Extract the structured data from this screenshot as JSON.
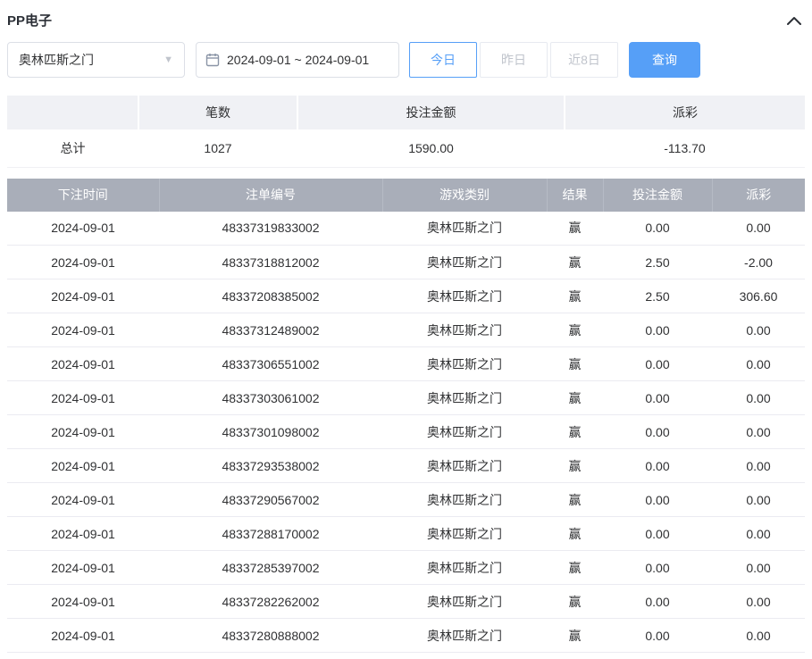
{
  "header": {
    "title": "PP电子"
  },
  "filters": {
    "game_select": {
      "value": "奥林匹斯之门"
    },
    "date_range": {
      "value": "2024-09-01 ~ 2024-09-01"
    },
    "quick_buttons": [
      {
        "label": "今日",
        "active": true
      },
      {
        "label": "昨日",
        "active": false
      },
      {
        "label": "近8日",
        "active": false
      }
    ],
    "search_label": "查询"
  },
  "summary": {
    "headers": [
      "",
      "笔数",
      "投注金额",
      "派彩"
    ],
    "row": {
      "label": "总计",
      "count": "1027",
      "bet_amount": "1590.00",
      "payout": "-113.70"
    }
  },
  "records": {
    "headers": [
      "下注时间",
      "注单编号",
      "游戏类别",
      "结果",
      "投注金额",
      "派彩"
    ],
    "rows": [
      {
        "date": "2024-09-01",
        "order_id": "48337319833002",
        "game": "奥林匹斯之门",
        "result": "赢",
        "bet": "0.00",
        "payout": "0.00"
      },
      {
        "date": "2024-09-01",
        "order_id": "48337318812002",
        "game": "奥林匹斯之门",
        "result": "赢",
        "bet": "2.50",
        "payout": "-2.00"
      },
      {
        "date": "2024-09-01",
        "order_id": "48337208385002",
        "game": "奥林匹斯之门",
        "result": "赢",
        "bet": "2.50",
        "payout": "306.60"
      },
      {
        "date": "2024-09-01",
        "order_id": "48337312489002",
        "game": "奥林匹斯之门",
        "result": "赢",
        "bet": "0.00",
        "payout": "0.00"
      },
      {
        "date": "2024-09-01",
        "order_id": "48337306551002",
        "game": "奥林匹斯之门",
        "result": "赢",
        "bet": "0.00",
        "payout": "0.00"
      },
      {
        "date": "2024-09-01",
        "order_id": "48337303061002",
        "game": "奥林匹斯之门",
        "result": "赢",
        "bet": "0.00",
        "payout": "0.00"
      },
      {
        "date": "2024-09-01",
        "order_id": "48337301098002",
        "game": "奥林匹斯之门",
        "result": "赢",
        "bet": "0.00",
        "payout": "0.00"
      },
      {
        "date": "2024-09-01",
        "order_id": "48337293538002",
        "game": "奥林匹斯之门",
        "result": "赢",
        "bet": "0.00",
        "payout": "0.00"
      },
      {
        "date": "2024-09-01",
        "order_id": "48337290567002",
        "game": "奥林匹斯之门",
        "result": "赢",
        "bet": "0.00",
        "payout": "0.00"
      },
      {
        "date": "2024-09-01",
        "order_id": "48337288170002",
        "game": "奥林匹斯之门",
        "result": "赢",
        "bet": "0.00",
        "payout": "0.00"
      },
      {
        "date": "2024-09-01",
        "order_id": "48337285397002",
        "game": "奥林匹斯之门",
        "result": "赢",
        "bet": "0.00",
        "payout": "0.00"
      },
      {
        "date": "2024-09-01",
        "order_id": "48337282262002",
        "game": "奥林匹斯之门",
        "result": "赢",
        "bet": "0.00",
        "payout": "0.00"
      },
      {
        "date": "2024-09-01",
        "order_id": "48337280888002",
        "game": "奥林匹斯之门",
        "result": "赢",
        "bet": "0.00",
        "payout": "0.00"
      }
    ]
  },
  "colors": {
    "accent": "#569ff7",
    "negative": "#f5494d",
    "table_header_bg": "#a9aeb9"
  }
}
